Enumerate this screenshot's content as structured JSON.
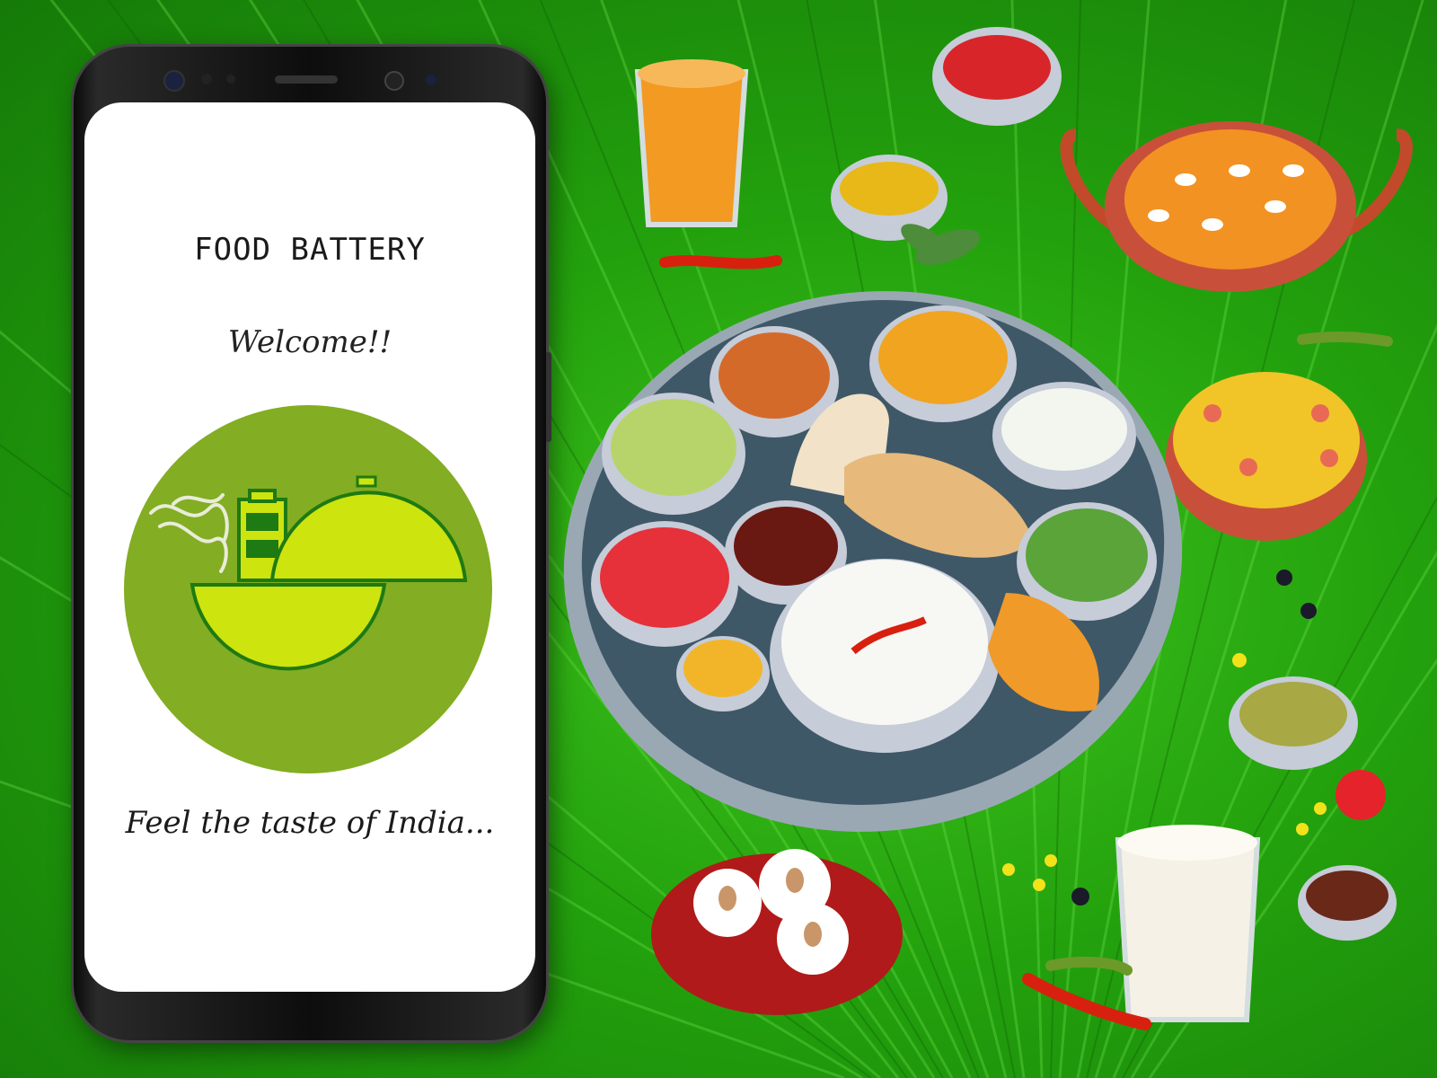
{
  "app": {
    "title": "FOOD BATTERY",
    "welcome": "Welcome!!",
    "tagline": "Feel the taste of India..."
  },
  "colors": {
    "background_green": "#23a10d",
    "logo_circle": "#83ad22",
    "logo_accent": "#cde40f",
    "logo_dark": "#1e7a12"
  },
  "icons": {
    "logo": "steaming-food-bowl-with-lid-icon"
  }
}
